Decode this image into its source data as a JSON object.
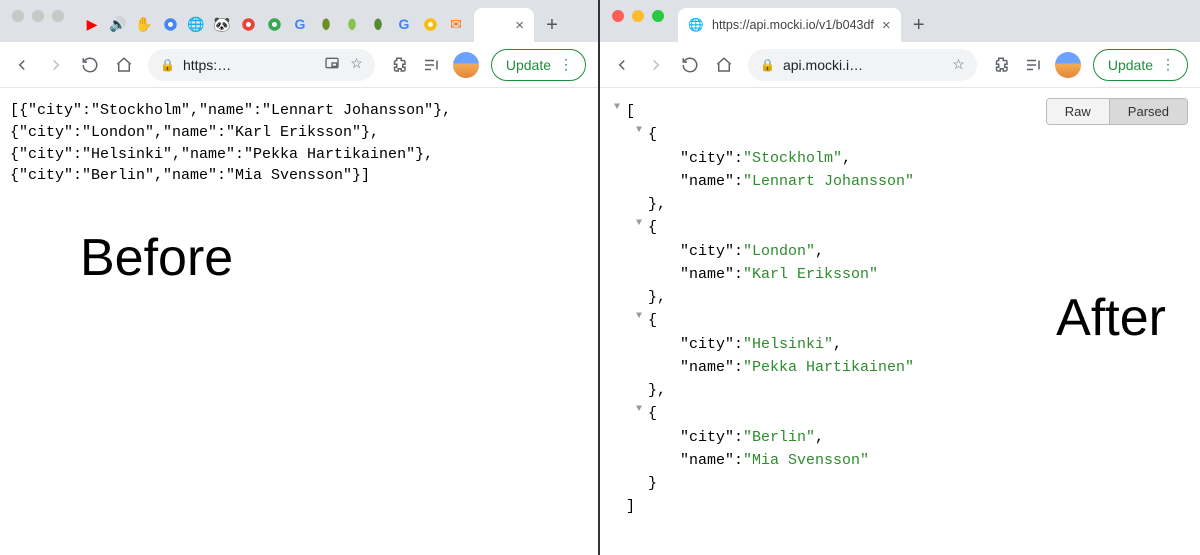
{
  "left": {
    "tab_title": "",
    "address": "https:…",
    "update_label": "Update",
    "big_label": "Before",
    "raw_text": "[{\"city\":\"Stockholm\",\"name\":\"Lennart Johansson\"},\n{\"city\":\"London\",\"name\":\"Karl Eriksson\"},\n{\"city\":\"Helsinki\",\"name\":\"Pekka Hartikainen\"},\n{\"city\":\"Berlin\",\"name\":\"Mia Svensson\"}]"
  },
  "right": {
    "tab_title": "https://api.mocki.io/v1/b043df",
    "address": "api.mocki.i…",
    "update_label": "Update",
    "big_label": "After",
    "toolbar": {
      "raw": "Raw",
      "parsed": "Parsed"
    }
  },
  "json_data": [
    {
      "city": "Stockholm",
      "name": "Lennart Johansson"
    },
    {
      "city": "London",
      "name": "Karl Eriksson"
    },
    {
      "city": "Helsinki",
      "name": "Pekka Hartikainen"
    },
    {
      "city": "Berlin",
      "name": "Mia Svensson"
    }
  ],
  "chart_data": {
    "type": "table",
    "columns": [
      "city",
      "name"
    ],
    "rows": [
      [
        "Stockholm",
        "Lennart Johansson"
      ],
      [
        "London",
        "Karl Eriksson"
      ],
      [
        "Helsinki",
        "Pekka Hartikainen"
      ],
      [
        "Berlin",
        "Mia Svensson"
      ]
    ]
  }
}
